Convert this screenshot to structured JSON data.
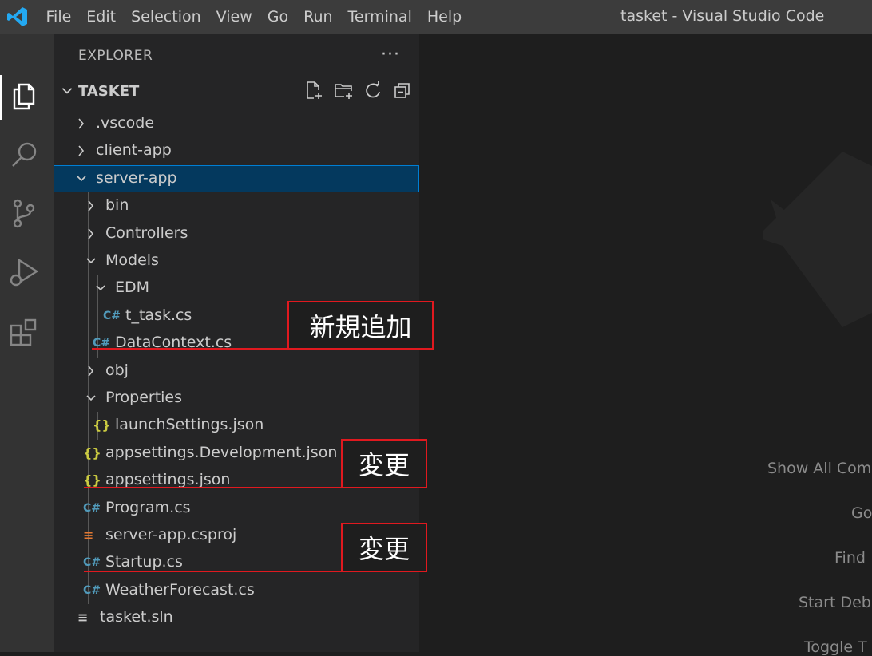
{
  "titlebar": {
    "menu": [
      "File",
      "Edit",
      "Selection",
      "View",
      "Go",
      "Run",
      "Terminal",
      "Help"
    ],
    "window_title": "tasket - Visual Studio Code",
    "logo_color": "#23a9f2"
  },
  "activity_bar": {
    "icons": [
      "explorer-icon",
      "search-icon",
      "source-control-icon",
      "run-debug-icon",
      "extensions-icon"
    ],
    "active": "explorer-icon"
  },
  "sidebar": {
    "title": "EXPLORER",
    "more": "···",
    "section_title": "TASKET",
    "header_actions": [
      "new-file-icon",
      "new-folder-icon",
      "refresh-icon",
      "collapse-all-icon"
    ],
    "tree": [
      {
        "label": ".vscode",
        "type": "folder",
        "expanded": false
      },
      {
        "label": "client-app",
        "type": "folder",
        "expanded": false
      },
      {
        "label": "server-app",
        "type": "folder",
        "expanded": true,
        "selected": true
      },
      {
        "label": "bin",
        "type": "folder",
        "expanded": false
      },
      {
        "label": "Controllers",
        "type": "folder",
        "expanded": false
      },
      {
        "label": "Models",
        "type": "folder",
        "expanded": true
      },
      {
        "label": "EDM",
        "type": "folder",
        "expanded": true
      },
      {
        "label": "t_task.cs",
        "type": "csharp"
      },
      {
        "label": "DataContext.cs",
        "type": "csharp"
      },
      {
        "label": "obj",
        "type": "folder",
        "expanded": false
      },
      {
        "label": "Properties",
        "type": "folder",
        "expanded": true
      },
      {
        "label": "launchSettings.json",
        "type": "json"
      },
      {
        "label": "appsettings.Development.json",
        "type": "json"
      },
      {
        "label": "appsettings.json",
        "type": "json"
      },
      {
        "label": "Program.cs",
        "type": "csharp"
      },
      {
        "label": "server-app.csproj",
        "type": "rss"
      },
      {
        "label": "Startup.cs",
        "type": "csharp"
      },
      {
        "label": "WeatherForecast.cs",
        "type": "csharp"
      },
      {
        "label": "tasket.sln",
        "type": "sln"
      }
    ],
    "icon_glyphs": {
      "csharp": "C#",
      "json": "{}",
      "rss": "࿿",
      "sln": "≡"
    },
    "colors": {
      "csharp": "#519aba",
      "json": "#cbcb41",
      "rss": "#e37933",
      "sln": "#cccccc",
      "selection": "#04395e",
      "focus_border": "#007fd4"
    }
  },
  "editor": {
    "hints": [
      "Show All Com",
      "Go",
      "Find",
      "Start Deb",
      "Toggle T"
    ]
  },
  "annotations": [
    {
      "text": "新規追加",
      "color": "#e0191f"
    },
    {
      "text": "変更",
      "color": "#e0191f"
    },
    {
      "text": "変更",
      "color": "#e0191f"
    }
  ]
}
